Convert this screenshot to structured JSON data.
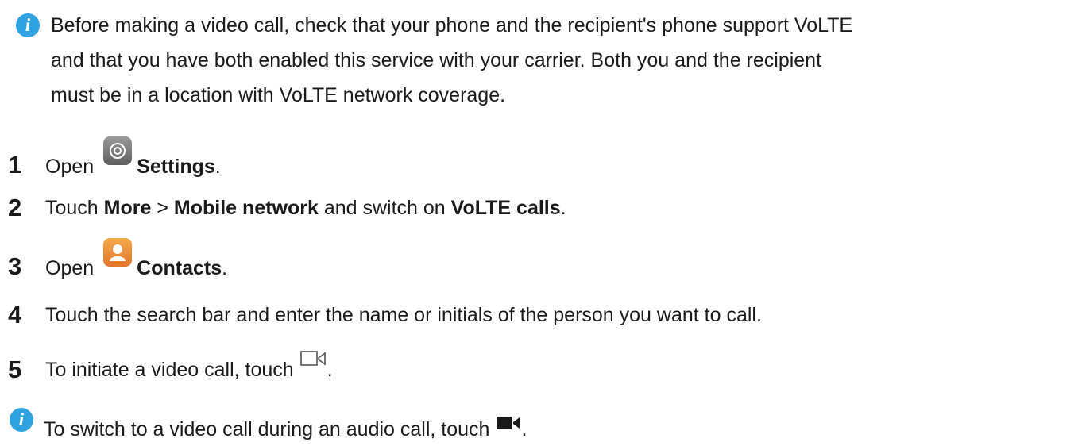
{
  "intro_note": {
    "icon": "info-icon",
    "icon_glyph": "i",
    "icon_color": "#2ea3e0",
    "line1": "Before making a video call, check that your phone and the recipient's phone support VoLTE",
    "line2": "and that you have both enabled this service with your carrier. Both you and the recipient",
    "line3": "must be in a location with VoLTE network coverage."
  },
  "steps": [
    {
      "number": "1",
      "parts": [
        "Open",
        "Settings",
        "."
      ],
      "icon": "settings-app-icon"
    },
    {
      "number": "2",
      "parts": [
        "Touch ",
        "More",
        " > ",
        "Mobile network",
        " and switch on ",
        "VoLTE calls",
        "."
      ]
    },
    {
      "number": "3",
      "parts": [
        "Open",
        "Contacts",
        "."
      ],
      "icon": "contacts-app-icon"
    },
    {
      "number": "4",
      "text": "Touch the search bar and enter the name or initials of the person you want to call."
    },
    {
      "number": "5",
      "parts": [
        "To initiate a video call, touch",
        "."
      ],
      "icon": "video-call-outline-icon"
    }
  ],
  "tip_note": {
    "icon": "info-icon",
    "icon_glyph": "i",
    "parts": [
      "To switch to a video call during an audio call, touch",
      "."
    ],
    "inline_icon": "video-camera-filled-icon"
  }
}
